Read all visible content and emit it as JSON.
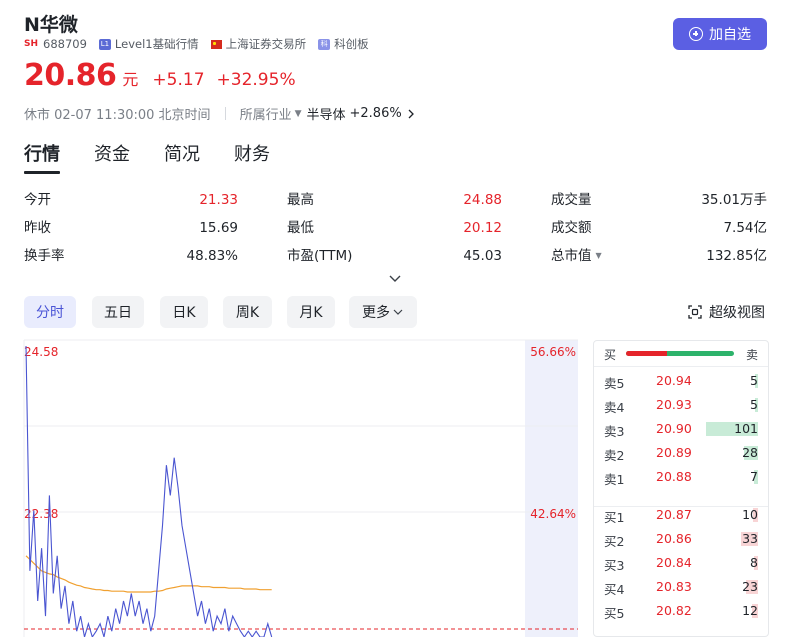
{
  "stock": {
    "name": "N华微",
    "exchange_tag": "SH",
    "code": "688709",
    "level_badge": "L1",
    "level_label": "Level1基础行情",
    "exchange_name": "上海证券交易所",
    "board_badge": "科",
    "board": "科创板",
    "price": "20.86",
    "unit": "元",
    "change": "+5.17",
    "change_pct": "+32.95%",
    "status": "休市 02-07 11:30:00 北京时间",
    "industry_label": "所属行业",
    "industry": "半导体",
    "industry_change": "+2.86%"
  },
  "add_button": {
    "label": "加自选",
    "icon": "plus-circle-icon"
  },
  "tabs": [
    "行情",
    "资金",
    "简况",
    "财务"
  ],
  "stats": [
    {
      "label": "今开",
      "value": "21.33",
      "color": "red"
    },
    {
      "label": "昨收",
      "value": "15.69",
      "color": "dark"
    },
    {
      "label": "换手率",
      "value": "48.83%",
      "color": "dark"
    },
    {
      "label": "最高",
      "value": "24.88",
      "color": "red"
    },
    {
      "label": "最低",
      "value": "20.12",
      "color": "red"
    },
    {
      "label": "市盈(TTM)",
      "value": "45.03",
      "color": "dark"
    },
    {
      "label": "成交量",
      "value": "35.01万手",
      "color": "dark"
    },
    {
      "label": "成交额",
      "value": "7.54亿",
      "color": "dark"
    },
    {
      "label": "总市值",
      "value": "132.85亿",
      "color": "dark",
      "has_dropdown": true
    }
  ],
  "periods": [
    "分时",
    "五日",
    "日K",
    "周K",
    "月K",
    "更多"
  ],
  "active_period": "分时",
  "super_view": "超级视图",
  "chart": {
    "y_top_label": "24.58",
    "y_mid_label": "22.38",
    "pct_top_label": "56.66%",
    "pct_mid_label": "42.64%",
    "baseline_price": 20.86,
    "price_series": [
      24.58,
      21.6,
      22.4,
      21.2,
      21.9,
      21.0,
      22.6,
      21.3,
      21.8,
      21.1,
      21.4,
      20.9,
      21.2,
      20.8,
      21.0,
      20.7,
      20.9,
      20.6,
      20.8,
      20.9,
      20.7,
      21.0,
      20.8,
      21.1,
      20.9,
      21.2,
      21.0,
      21.3,
      21.0,
      21.2,
      20.9,
      21.1,
      20.8,
      21.0,
      21.6,
      22.2,
      23.0,
      22.6,
      23.1,
      22.7,
      22.2,
      21.9,
      21.6,
      21.3,
      21.0,
      21.2,
      20.9,
      21.1,
      20.8,
      21.0,
      20.9,
      21.1,
      20.8,
      21.0,
      20.9,
      20.8,
      20.7,
      20.8,
      20.6,
      20.8,
      20.5,
      20.6,
      20.9,
      20.6
    ],
    "avg_series": [
      21.8,
      21.75,
      21.7,
      21.65,
      21.6,
      21.58,
      21.56,
      21.55,
      21.52,
      21.5,
      21.48,
      21.45,
      21.43,
      21.41,
      21.4,
      21.38,
      21.37,
      21.36,
      21.35,
      21.35,
      21.34,
      21.34,
      21.33,
      21.33,
      21.33,
      21.33,
      21.32,
      21.32,
      21.32,
      21.32,
      21.32,
      21.32,
      21.32,
      21.33,
      21.33,
      21.34,
      21.36,
      21.37,
      21.38,
      21.39,
      21.4,
      21.4,
      21.4,
      21.4,
      21.4,
      21.39,
      21.39,
      21.39,
      21.38,
      21.38,
      21.38,
      21.38,
      21.37,
      21.37,
      21.37,
      21.37,
      21.36,
      21.36,
      21.36,
      21.36,
      21.35,
      21.35,
      21.35,
      21.35
    ]
  },
  "order_book": {
    "buy_label": "买",
    "sell_label": "卖",
    "ratio_buy": 0.38,
    "asks": [
      {
        "label": "卖5",
        "price": "20.94",
        "volume": "5"
      },
      {
        "label": "卖4",
        "price": "20.93",
        "volume": "5"
      },
      {
        "label": "卖3",
        "price": "20.90",
        "volume": "101"
      },
      {
        "label": "卖2",
        "price": "20.89",
        "volume": "28"
      },
      {
        "label": "卖1",
        "price": "20.88",
        "volume": "7"
      }
    ],
    "bids": [
      {
        "label": "买1",
        "price": "20.87",
        "volume": "10"
      },
      {
        "label": "买2",
        "price": "20.86",
        "volume": "33"
      },
      {
        "label": "买3",
        "price": "20.84",
        "volume": "8"
      },
      {
        "label": "买4",
        "price": "20.83",
        "volume": "23"
      },
      {
        "label": "买5",
        "price": "20.82",
        "volume": "12"
      }
    ],
    "colors": {
      "buy": "#e5242b",
      "sell": "#2db36b",
      "ask_bar": "#c8ebd7",
      "bid_bar": "#f8d4d5"
    }
  },
  "colors": {
    "accent": "#5b5fe3",
    "up": "#e5242b",
    "price_line": "#4a55d1",
    "avg_line": "#f0a030",
    "chart_band": "#eef0fb"
  }
}
